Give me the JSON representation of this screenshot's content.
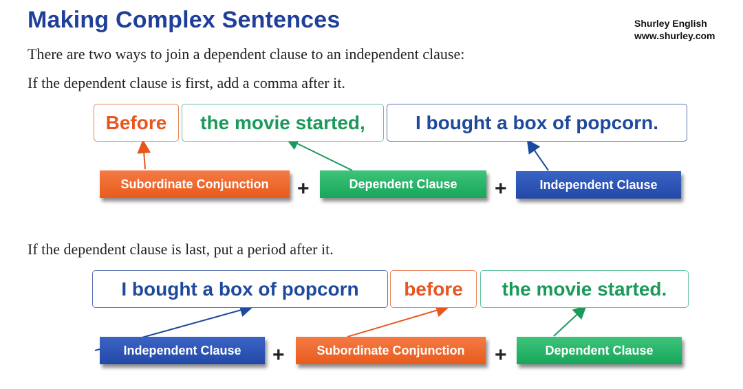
{
  "header": {
    "title": "Making Complex Sentences",
    "brand_name": "Shurley English",
    "brand_url": "www.shurley.com"
  },
  "intro": "There are two ways to join a dependent clause to an independent clause:",
  "example1": {
    "rule": "If the dependent clause is first, add a comma after it.",
    "boxes": [
      "Before",
      "the movie started,",
      "I bought a box of popcorn."
    ],
    "labels": [
      "Subordinate Conjunction",
      "Dependent Clause",
      "Independent Clause"
    ],
    "plus": "+"
  },
  "example2": {
    "rule": "If the dependent clause is last, put a period after it.",
    "boxes": [
      "I bought a box of popcorn",
      "before",
      "the movie started."
    ],
    "labels": [
      "Independent Clause",
      "Subordinate Conjunction",
      "Dependent Clause"
    ],
    "plus": "+"
  },
  "colors": {
    "title": "#1f3f9a",
    "conjunction": "#e8561f",
    "dependent": "#1a9a5a",
    "independent": "#1d4a9c"
  }
}
